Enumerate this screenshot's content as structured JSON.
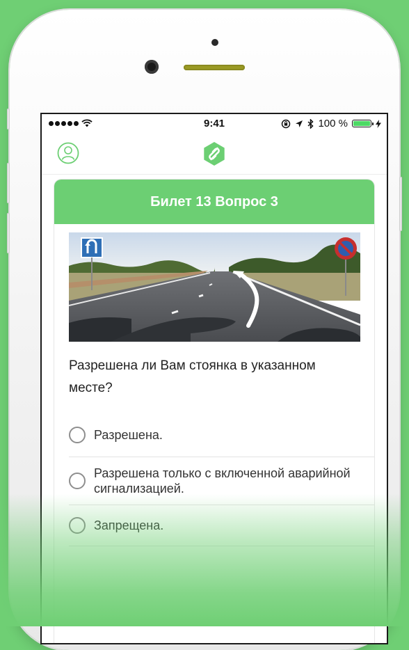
{
  "status_bar": {
    "time": "9:41",
    "battery_percent": "100 %",
    "battery_level": 1.0
  },
  "nav": {
    "profile_icon": "user-profile-icon",
    "logo_icon": "app-logo-icon"
  },
  "ticket": {
    "title": "Билет 13 Вопрос 3",
    "question": "Разрешена ли Вам стоянка в указанном месте?",
    "answers": [
      {
        "text": "Разрешена."
      },
      {
        "text": "Разрешена только с включенной аварийной сигнализацией."
      },
      {
        "text": "Запрещена."
      }
    ]
  },
  "colors": {
    "accent": "#6ccf73",
    "background": "#6fcf74"
  }
}
